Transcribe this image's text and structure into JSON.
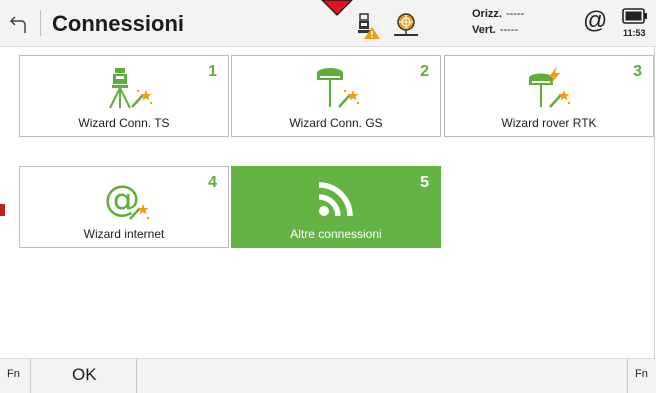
{
  "header": {
    "title": "Connessioni",
    "accuracy": {
      "h_label": "Orizz.",
      "h_value": "-----",
      "v_label": "Vert.",
      "v_value": "-----"
    },
    "internet_symbol": "@",
    "time": "11:53",
    "icons": [
      "back-arrow-icon",
      "total-station-warning-icon",
      "prism-icon",
      "battery-icon"
    ]
  },
  "tiles": [
    {
      "number": "1",
      "label": "Wizard Conn. TS",
      "icon": "total-station-wizard-icon"
    },
    {
      "number": "2",
      "label": "Wizard Conn. GS",
      "icon": "gnss-wizard-icon"
    },
    {
      "number": "3",
      "label": "Wizard rover RTK",
      "icon": "rtk-rover-wizard-icon"
    },
    {
      "number": "4",
      "label": "Wizard internet",
      "icon": "internet-wizard-icon"
    },
    {
      "number": "5",
      "label": "Altre connessioni",
      "icon": "wireless-icon",
      "selected": true
    }
  ],
  "footer": {
    "fn_left": "Fn",
    "ok_label": "OK",
    "fn_right": "Fn"
  },
  "colors": {
    "accent": "#66b345",
    "accent_number": "#5fae3c",
    "orange": "#f39c12",
    "warning_red": "#e0141c"
  }
}
